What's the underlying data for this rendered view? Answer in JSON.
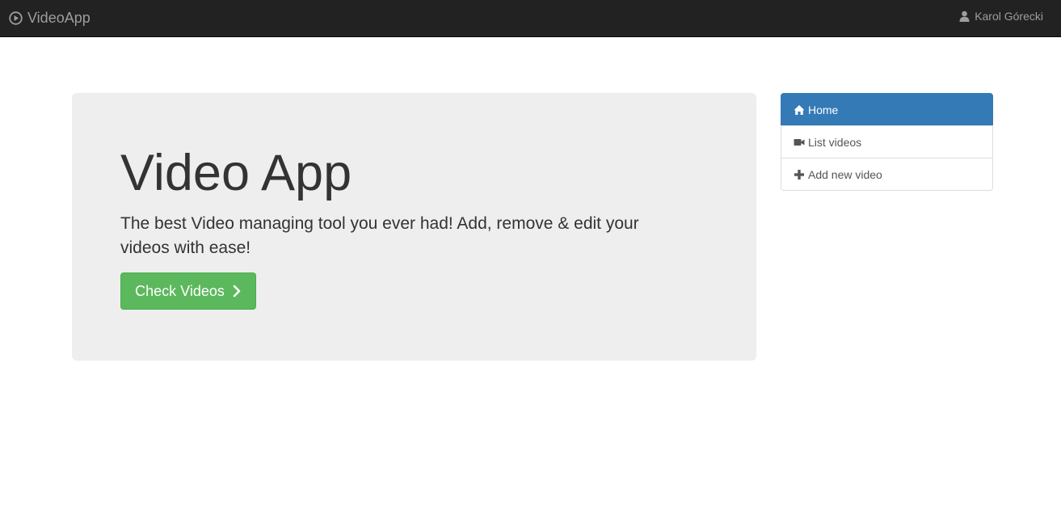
{
  "navbar": {
    "brand_label": "VideoApp",
    "brand_icon": "play-circle-icon",
    "user_name": "Karol Górecki",
    "user_icon": "user-icon"
  },
  "jumbotron": {
    "title": "Video App",
    "description": "The best Video managing tool you ever had! Add, remove & edit your videos with ease!",
    "button_label": "Check Videos",
    "button_icon": "chevron-right-icon"
  },
  "sidebar": {
    "items": [
      {
        "label": "Home",
        "icon": "home-icon",
        "active": true
      },
      {
        "label": "List videos",
        "icon": "video-camera-icon",
        "active": false
      },
      {
        "label": "Add new video",
        "icon": "plus-icon",
        "active": false
      }
    ]
  },
  "colors": {
    "navbar_bg": "#222222",
    "navbar_text": "#9d9d9d",
    "jumbotron_bg": "#eeeeee",
    "button_green": "#5cb85c",
    "active_blue": "#337ab7"
  }
}
